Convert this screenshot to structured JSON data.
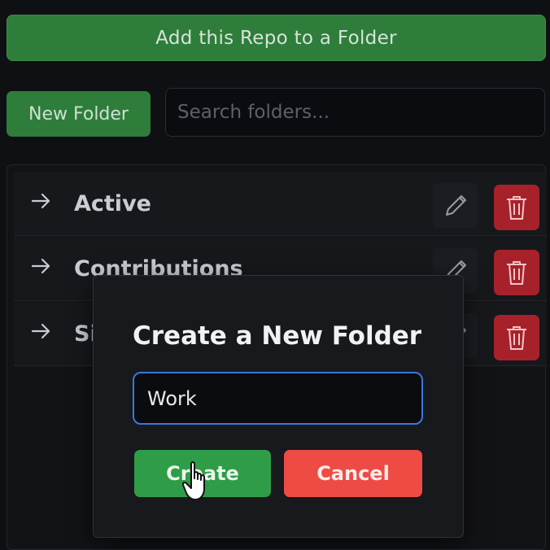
{
  "header": {
    "add_repo_label": "Add this Repo to a Folder"
  },
  "toolbar": {
    "new_folder_label": "New Folder",
    "search_placeholder": "Search folders..."
  },
  "folders": [
    {
      "label": "Active"
    },
    {
      "label": "Contributions"
    },
    {
      "label": "Side"
    }
  ],
  "modal": {
    "title": "Create a New Folder",
    "input_value": "Work",
    "create_label": "Create",
    "cancel_label": "Cancel"
  },
  "colors": {
    "primary_green": "#2e7d3a",
    "create_green": "#2f9d48",
    "cancel_red": "#ee4b45",
    "delete_red": "#a7212b",
    "focus_blue": "#3a78d8"
  },
  "icons": {
    "row_arrow": "arrow-right-icon",
    "edit": "pencil-icon",
    "delete": "trash-icon",
    "cursor": "hand-pointer-icon"
  }
}
